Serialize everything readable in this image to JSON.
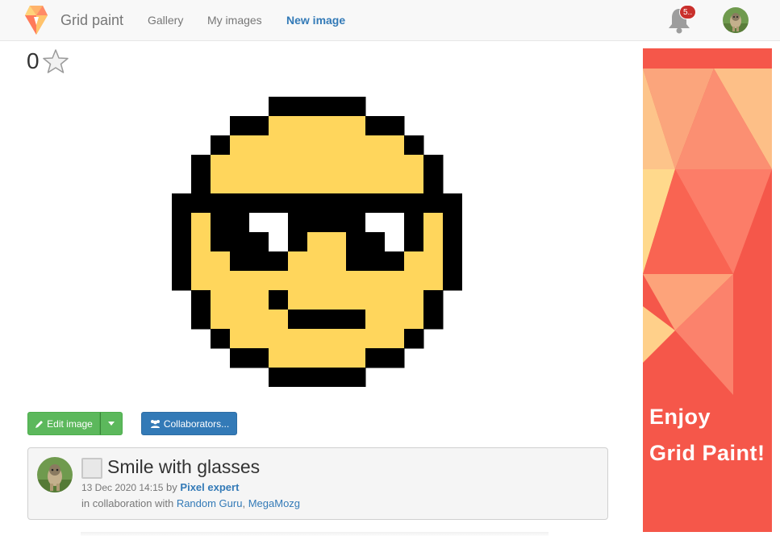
{
  "navbar": {
    "brand": "Grid paint",
    "links": [
      "Gallery",
      "My images",
      "New image"
    ],
    "active_link": "New image",
    "notification_count": "5..",
    "icons": {
      "logo": "grid-paint-logo",
      "bell": "bell-icon",
      "avatar": "user-avatar"
    }
  },
  "rating": {
    "count": "0",
    "icon": "star-icon"
  },
  "artwork": {
    "palette": {
      "k": "#000000",
      "y": "#ffd65c",
      "w": "#ffffff"
    },
    "rows": [
      "_____kkkkk_____",
      "___kkyyyyykk___",
      "__kyyyyyyyyyk__",
      "_kyyyyyyyyyyyk_",
      "_kyyyyyyyyyyyk_",
      "kkkkkkkkkkkkkkk",
      "kykkwwkkkkwwkyk",
      "kykkkwkyykkwkyk",
      "kyykkkyyykkkyyk",
      "kyyyyyyyyyyyyyk",
      "_kyyykyyyyyyyk_",
      "_kyyyykkkkyyyk_",
      "__kyyyyyyyyyk__",
      "___kkyyyyykk___",
      "_____kkkkk_____"
    ]
  },
  "actions": {
    "edit_label": "Edit image",
    "collaborators_label": "Collaborators..."
  },
  "image_info": {
    "title": "Smile with glasses",
    "date": "13 Dec 2020 14:15",
    "by_label": "by",
    "author": "Pixel expert",
    "collab_prefix": "in collaboration with",
    "collaborators": [
      "Random Guru",
      "MegaMozg"
    ],
    "separator": ","
  },
  "ad": {
    "line1": "Enjoy",
    "line2": "Grid Paint!",
    "background": "#f5574a"
  },
  "colors": {
    "accent": "#337ab7",
    "success": "#5cb85c",
    "badge": "#c9302c",
    "ad": "#f5574a"
  }
}
